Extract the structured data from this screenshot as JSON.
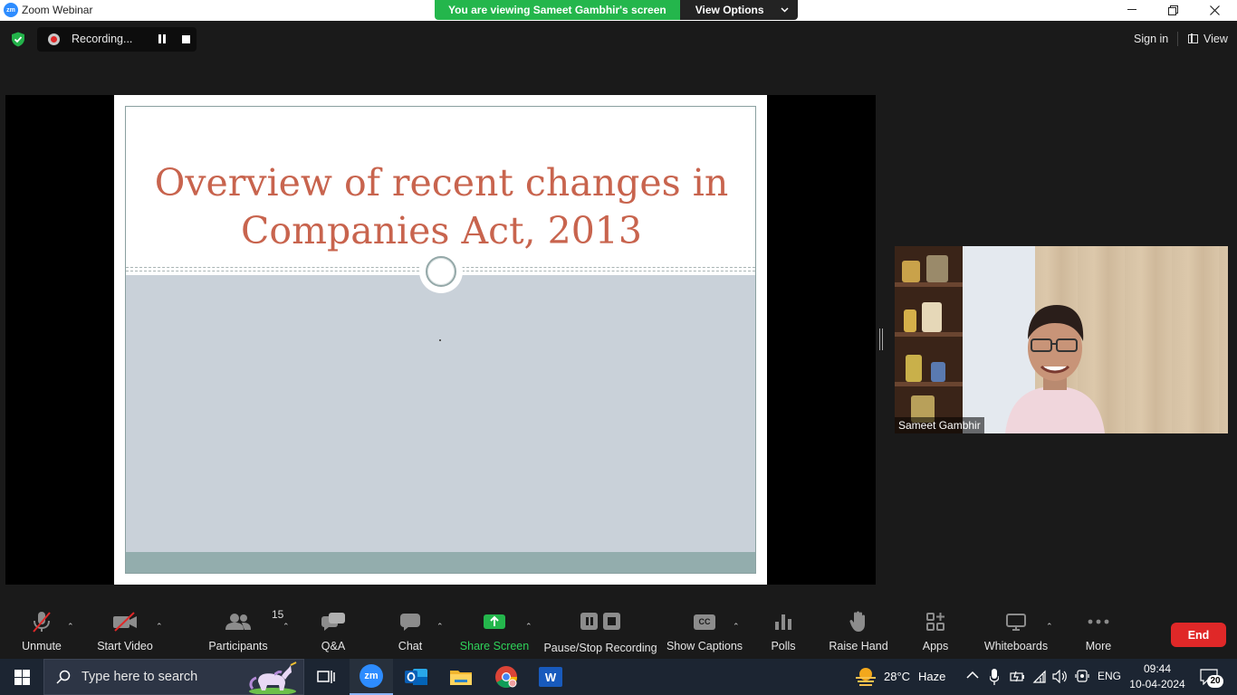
{
  "window": {
    "title": "Zoom Webinar",
    "logo_text": "zm",
    "minimize": "—",
    "restore": "❐",
    "close": "✕"
  },
  "banner": {
    "viewing_text": "You are viewing Sameet Gambhir's screen",
    "view_options_label": "View Options"
  },
  "recording": {
    "status_label": "Recording..."
  },
  "topbar": {
    "signin_label": "Sign in",
    "view_label": "View"
  },
  "slide": {
    "title_line1": "Overview of recent changes in",
    "title_line2": "Companies Act, 2013"
  },
  "video": {
    "participant_name": "Sameet Gambhir"
  },
  "toolbar": {
    "unmute": "Unmute",
    "start_video": "Start Video",
    "participants": "Participants",
    "participants_count": "15",
    "qa": "Q&A",
    "chat": "Chat",
    "share_screen": "Share Screen",
    "pause_stop_recording": "Pause/Stop Recording",
    "show_captions": "Show Captions",
    "captions_icon_text": "CC",
    "polls": "Polls",
    "raise_hand": "Raise Hand",
    "apps": "Apps",
    "whiteboards": "Whiteboards",
    "more": "More",
    "end": "End"
  },
  "taskbar": {
    "search_placeholder": "Type here to search",
    "weather_temp": "28°C",
    "weather_desc": "Haze",
    "language": "ENG",
    "time": "09:44",
    "date": "10-04-2024",
    "notification_count": "20",
    "zoom_label": "zm",
    "word_label": "W"
  },
  "colors": {
    "accent_green": "#24b64c",
    "end_red": "#e02828",
    "slide_title": "#c8644e",
    "zoom_blue": "#2d8cff"
  }
}
